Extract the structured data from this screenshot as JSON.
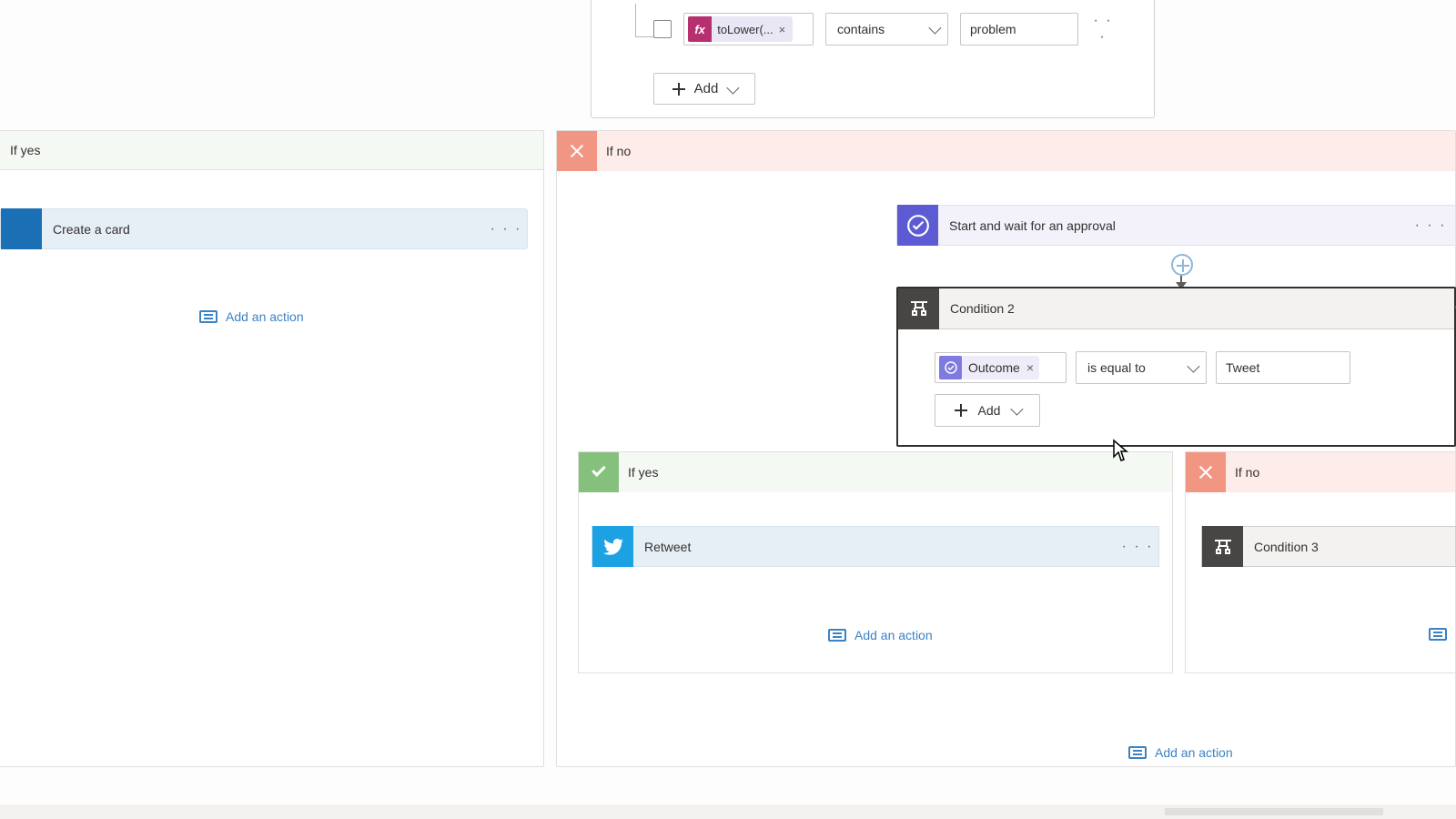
{
  "top": {
    "fx_label": "toLower(...",
    "operator": "contains",
    "value": "problem",
    "add": "Add"
  },
  "branches": {
    "if_yes": "If yes",
    "if_no": "If no"
  },
  "left": {
    "create_card": "Create a card",
    "add_action": "Add an action"
  },
  "right": {
    "approval": "Start and wait for an approval",
    "cond2": {
      "title": "Condition 2",
      "outcome": "Outcome",
      "operator": "is equal to",
      "value": "Tweet",
      "add": "Add"
    },
    "inner_yes": {
      "retweet": "Retweet",
      "add_action": "Add an action"
    },
    "inner_no": {
      "cond3": "Condition 3",
      "add_action": "Add an action"
    },
    "add_action_bottom": "Add an action"
  }
}
